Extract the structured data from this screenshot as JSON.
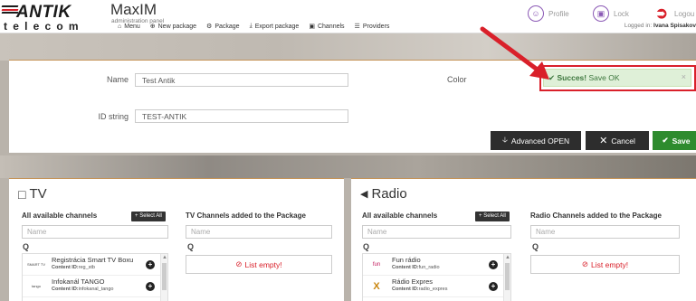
{
  "header": {
    "logo_text": "ANTIK",
    "logo_sub": "telecom",
    "app_title": "MaxIM",
    "app_subtitle": "administration panel",
    "menu": [
      {
        "icon": "home-icon",
        "glyph": "⌂",
        "label": "Menu"
      },
      {
        "icon": "plus-circle-icon",
        "glyph": "⊕",
        "label": "New package"
      },
      {
        "icon": "package-icon",
        "glyph": "⚙",
        "label": "Package"
      },
      {
        "icon": "export-icon",
        "glyph": "⤓",
        "label": "Export package"
      },
      {
        "icon": "channels-icon",
        "glyph": "▣",
        "label": "Channels"
      },
      {
        "icon": "providers-icon",
        "glyph": "☰",
        "label": "Providers"
      }
    ],
    "profile_label": "Profile",
    "lock_label": "Lock",
    "logout_label": "Logou",
    "logged_in_prefix": "Logged in:",
    "logged_in_user": "Ivana Spisakov"
  },
  "form": {
    "name_label": "Name",
    "name_value": "Test Antik",
    "color_label": "Color",
    "id_label": "ID string",
    "id_value": "TEST-ANTIK",
    "advanced_label": "Advanced OPEN",
    "cancel_label": "Cancel",
    "save_label": "Save"
  },
  "alert": {
    "title": "Succes!",
    "message": "Save OK",
    "close": "×"
  },
  "tv": {
    "title": "TV",
    "available_label": "All available channels",
    "select_all": "Select All",
    "added_label": "TV Channels added to the Package",
    "name_placeholder": "Name",
    "search_glyph": "Q",
    "channels": [
      {
        "logo": "SMART TV",
        "name": "Registrácia Smart TV Boxu",
        "id_label": "Content ID:",
        "id": "reg_stb"
      },
      {
        "logo": "tango",
        "name": "Infokanál TANGO",
        "id_label": "Content ID:",
        "id": "infokanal_tango"
      }
    ],
    "empty_text": "List empty!"
  },
  "radio": {
    "title": "Radio",
    "available_label": "All available channels",
    "select_all": "Select All",
    "added_label": "Radio Channels added to the Package",
    "name_placeholder": "Name",
    "search_glyph": "Q",
    "channels": [
      {
        "logo": "fun",
        "name": "Fun rádio",
        "id_label": "Content ID:",
        "id": "fun_radio"
      },
      {
        "logo": "X",
        "name": "Rádio Expres",
        "id_label": "Content ID:",
        "id": "radio_expres"
      }
    ],
    "empty_text": "List empty!"
  },
  "colors": {
    "accent_red": "#d9202a",
    "save_green": "#2e8b2e",
    "success_bg": "#dff0d8",
    "panel_border": "#c59357"
  }
}
